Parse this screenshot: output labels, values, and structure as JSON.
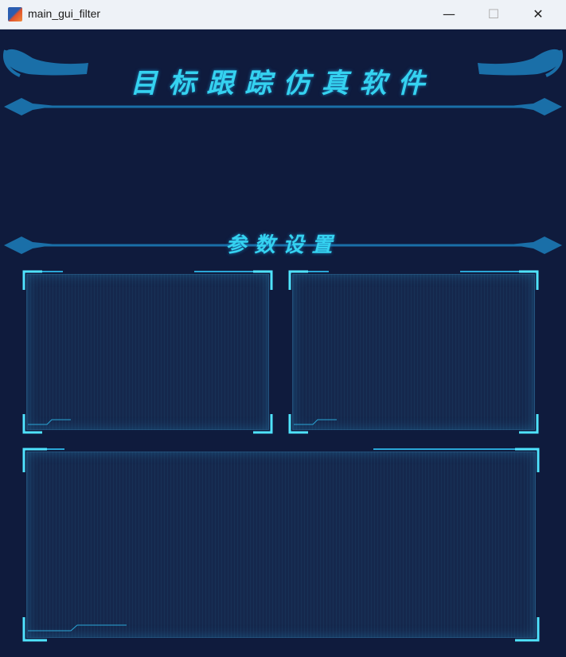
{
  "window": {
    "title": "main_gui_filter",
    "minimize_glyph": "—",
    "maximize_glyph": "☐",
    "close_glyph": "✕",
    "icon": "matlab-icon"
  },
  "header": {
    "title": "目标跟踪仿真软件"
  },
  "parameters": {
    "title": "参数设置"
  },
  "colors": {
    "background": "#0f1b3d",
    "accent": "#35d2f0",
    "ornament": "#1a6fa8"
  }
}
